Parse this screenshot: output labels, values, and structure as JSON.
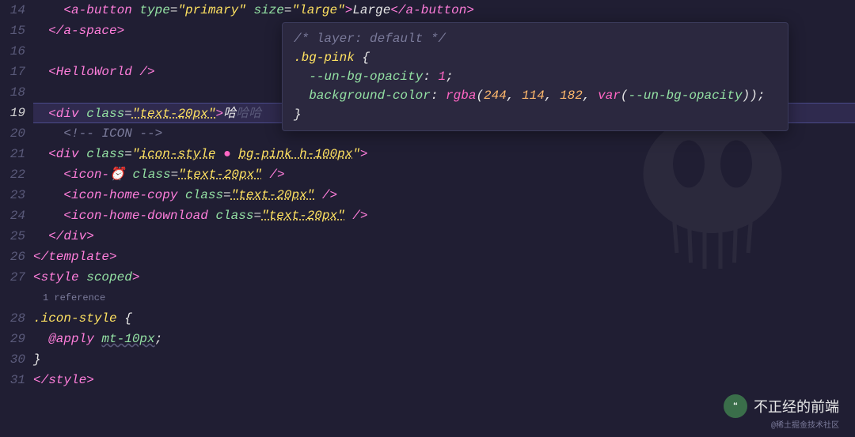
{
  "gutter": [
    "14",
    "15",
    "16",
    "17",
    "18",
    "19",
    "20",
    "21",
    "22",
    "23",
    "24",
    "25",
    "26",
    "27",
    "",
    "28",
    "29",
    "30",
    "31"
  ],
  "highlight_line": 19,
  "ref_text": "1 reference",
  "lines": {
    "l14": {
      "indent": "    ",
      "t1_open": "<a-button ",
      "attr1": "type",
      "eq": "=",
      "str1": "\"primary\"",
      "sp": " ",
      "attr2": "size",
      "str2": "\"large\"",
      "close": ">",
      "text": "Large",
      "end": "</a-button>"
    },
    "l15": {
      "indent": "  ",
      "end": "</a-space>"
    },
    "l17": {
      "indent": "  ",
      "t": "<HelloWorld />"
    },
    "l19": {
      "indent": "  ",
      "open": "<div ",
      "attr": "class",
      "eq": "=",
      "str": "\"text-20px\"",
      "close": ">",
      "text": "哈",
      "dim": "哈哈"
    },
    "l20": {
      "indent": "    ",
      "comment": "<!-- ICON -->"
    },
    "l21": {
      "indent": "  ",
      "open": "<div ",
      "attr": "class",
      "eq": "=",
      "q": "\"",
      "s1": "icon-style",
      "dot": " ● ",
      "s2": "bg-pink",
      "s3": " h-100px",
      "q2": "\"",
      "close": ">"
    },
    "l22": {
      "indent": "    ",
      "open": "<icon-⏰ ",
      "attr": "class",
      "eq": "=",
      "str": "\"text-20px\"",
      "close": " />"
    },
    "l23": {
      "indent": "    ",
      "open": "<icon-home-copy ",
      "attr": "class",
      "eq": "=",
      "str": "\"text-20px\"",
      "close": " />"
    },
    "l24": {
      "indent": "    ",
      "open": "<icon-home-download ",
      "attr": "class",
      "eq": "=",
      "str": "\"text-20px\"",
      "close": " />"
    },
    "l25": {
      "indent": "  ",
      "end": "</div>"
    },
    "l26": {
      "end": "</template>"
    },
    "l27": {
      "open": "<style ",
      "attr": "scoped",
      "close": ">"
    },
    "l28": {
      "sel": ".icon-style ",
      "brace": "{"
    },
    "l29": {
      "indent": "  ",
      "kw": "@apply ",
      "val": "mt-10px",
      "semi": ";"
    },
    "l30": {
      "brace": "}"
    },
    "l31": {
      "end": "</style>"
    }
  },
  "tooltip": {
    "c1": "/* layer: default */",
    "sel": ".bg-pink ",
    "brace1": "{",
    "prop1": "--un-bg-opacity",
    "colon": ": ",
    "val1": "1",
    "semi": ";",
    "prop2": "background-color",
    "fn": "rgba",
    "n1": "244",
    "n2": "114",
    "n3": "182",
    "vfn": "var",
    "vname": "--un-bg-opacity",
    "brace2": "}"
  },
  "watermark": {
    "text": "不正经的前端",
    "sub": "@稀土掘金技术社区"
  }
}
